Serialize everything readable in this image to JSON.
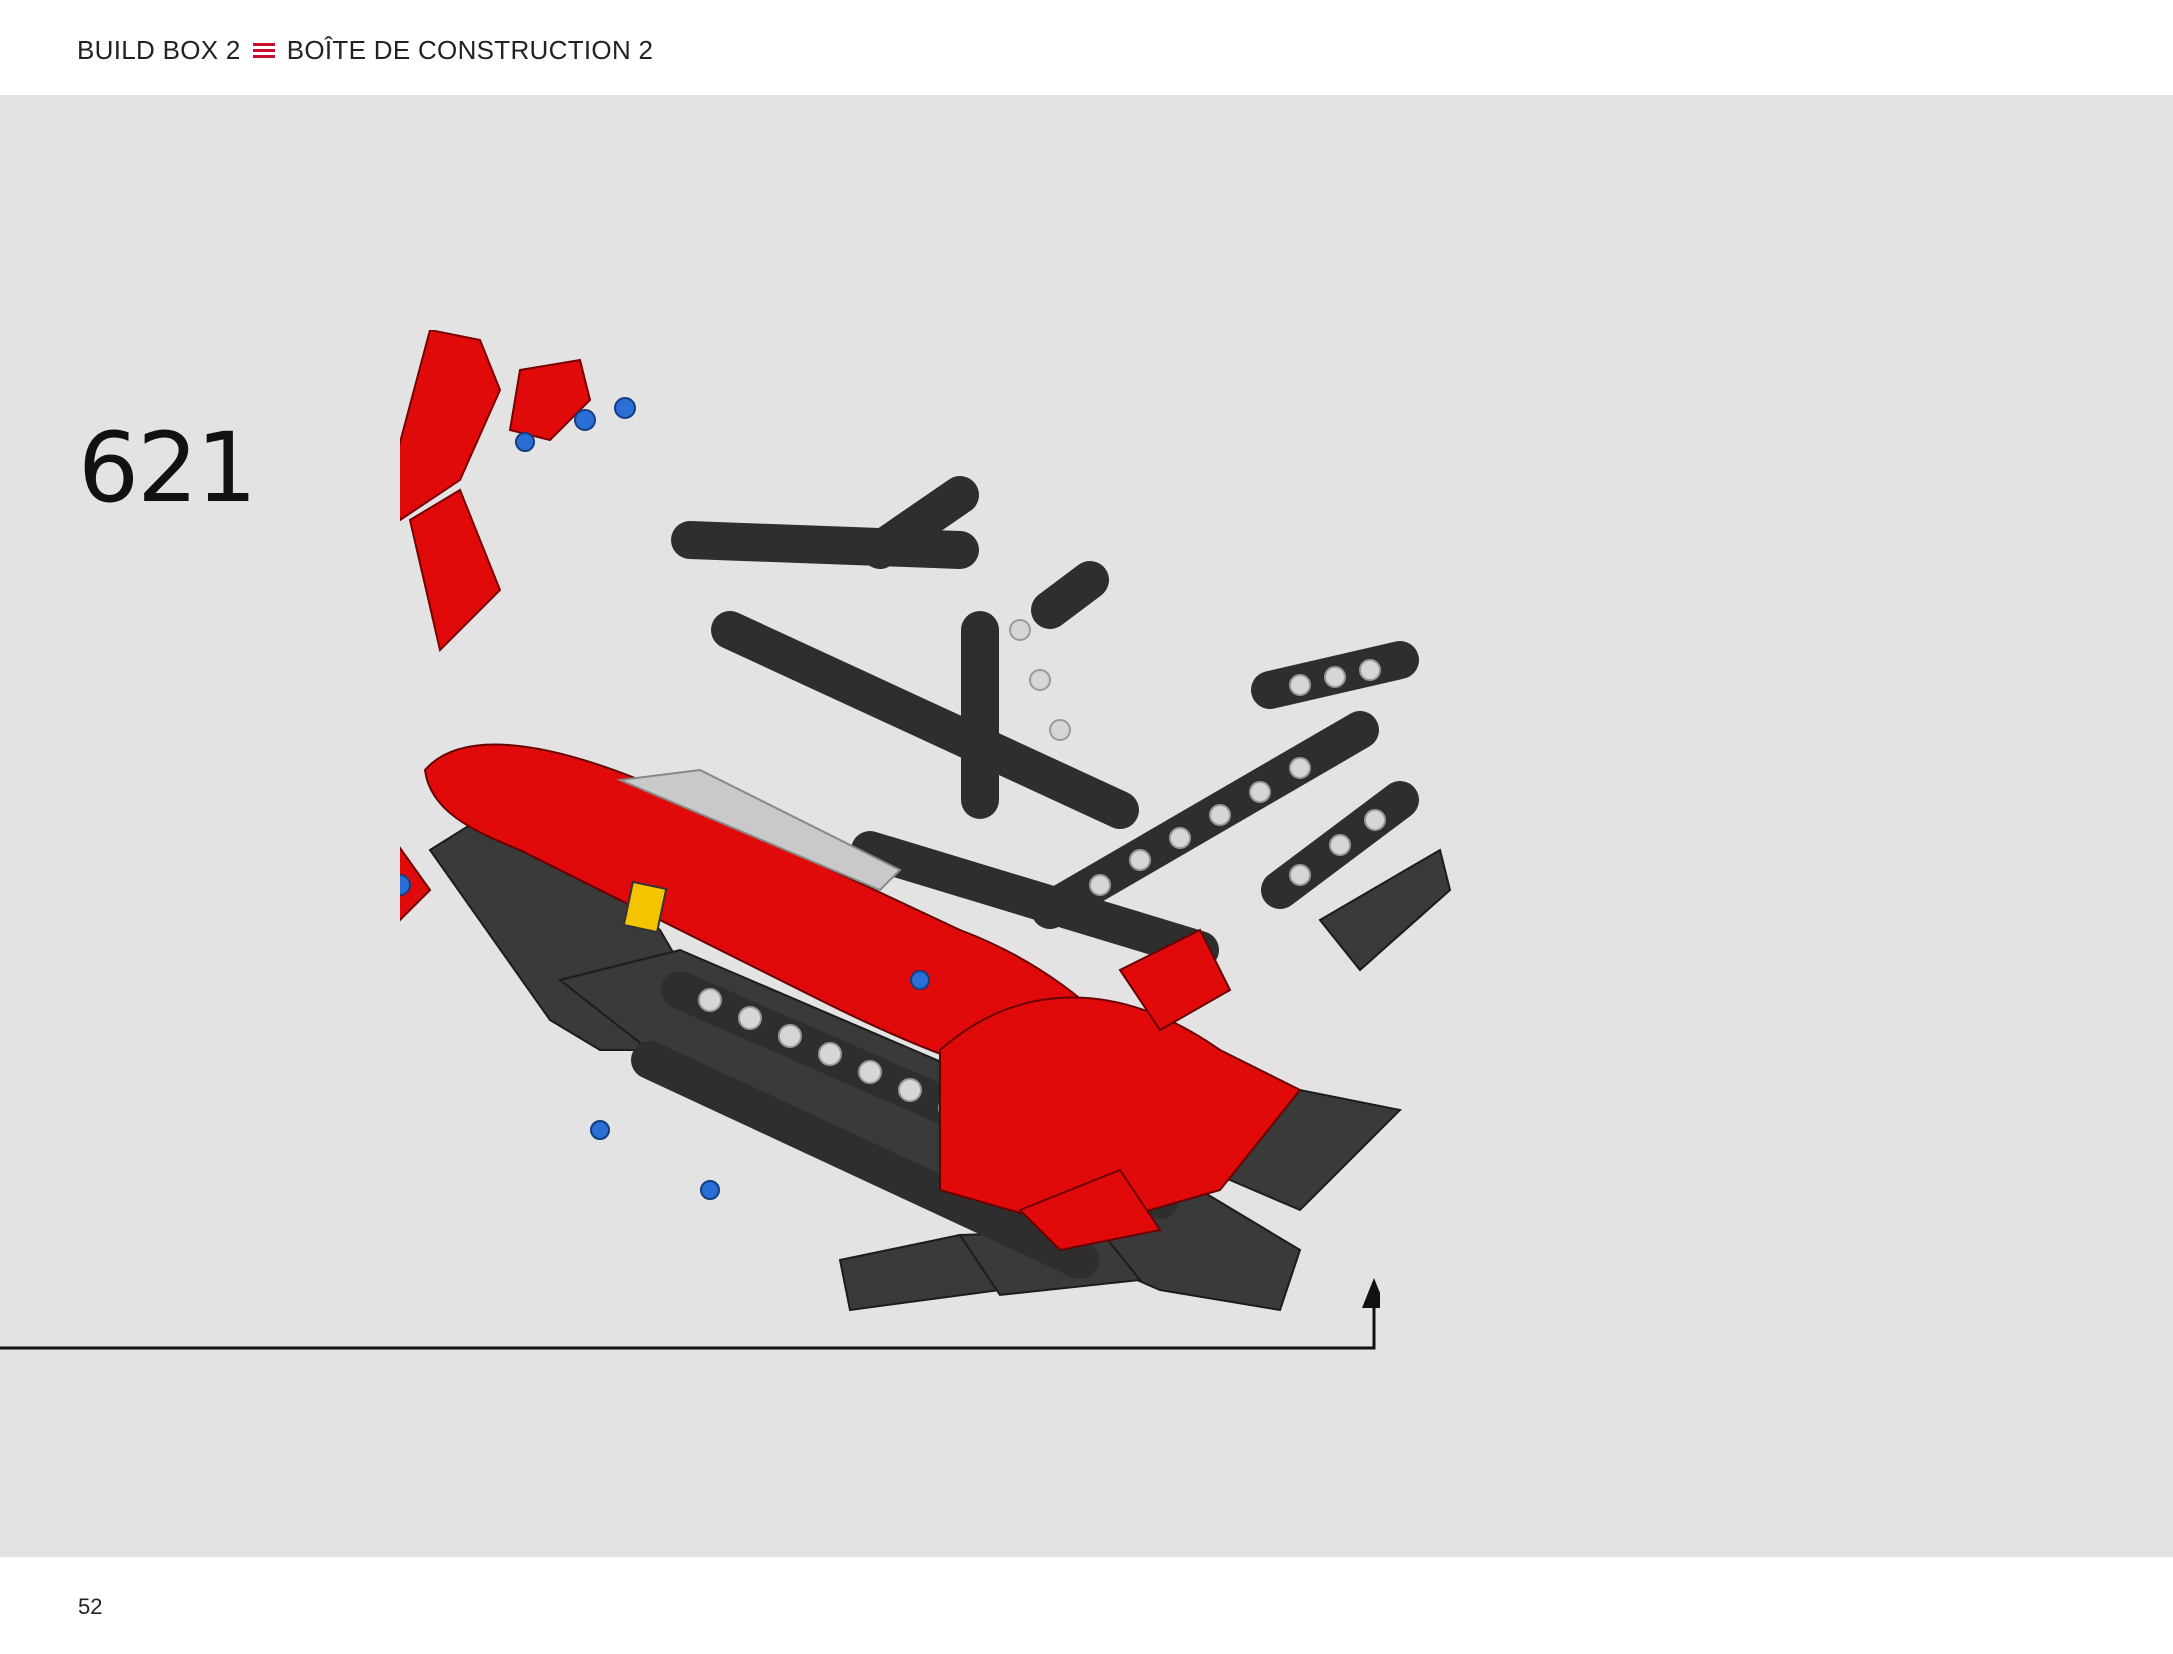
{
  "header": {
    "left_title": "BUILD BOX 2",
    "right_title": "BOÎTE DE CONSTRUCTION 2",
    "separator_icon": "triple-line-icon",
    "accent_color": "#c8102e"
  },
  "step": {
    "number": "621"
  },
  "illustration": {
    "colors": {
      "red": "#e10a0a",
      "dark": "#3a3a3a",
      "light_gray": "#c9c9c9",
      "background": "#e3e3e3"
    }
  },
  "footer": {
    "page_number": "52"
  }
}
